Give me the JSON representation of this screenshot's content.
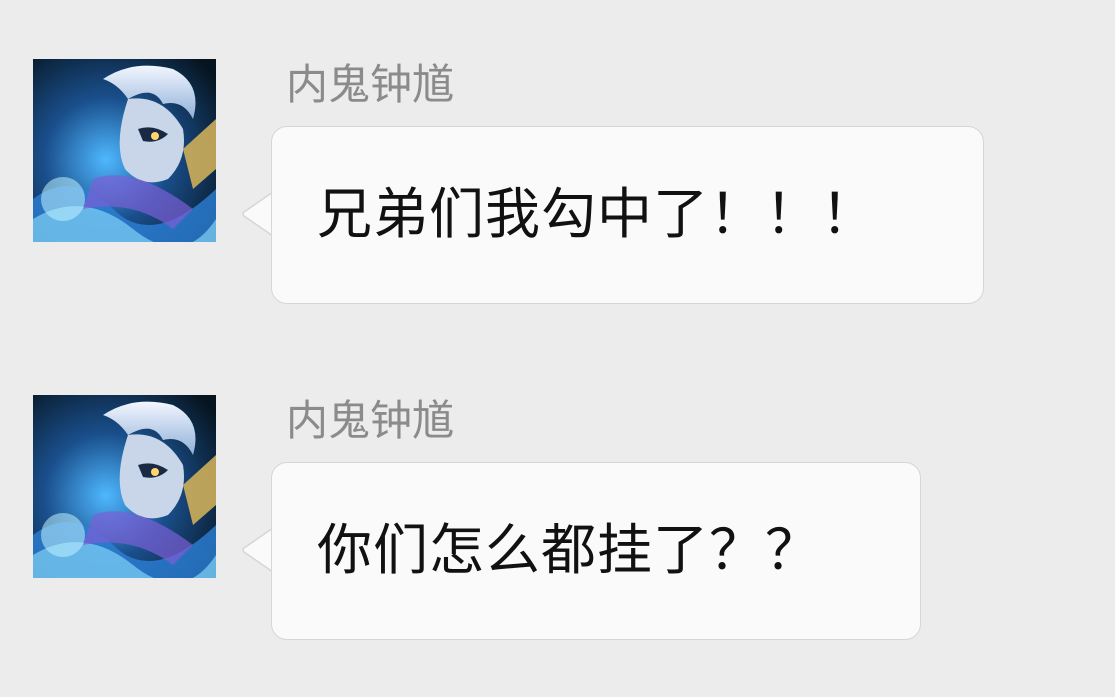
{
  "messages": [
    {
      "sender": "内鬼钟馗",
      "avatar_icon": "hero-avatar-icon",
      "text": "兄弟们我勾中了！！！"
    },
    {
      "sender": "内鬼钟馗",
      "avatar_icon": "hero-avatar-icon",
      "text": "你们怎么都挂了？？"
    }
  ],
  "colors": {
    "background": "#ececec",
    "bubble": "#fafafa",
    "bubble_border": "#d6d6d6",
    "sender_name": "#8b8b8b",
    "message_text": "#111111"
  }
}
